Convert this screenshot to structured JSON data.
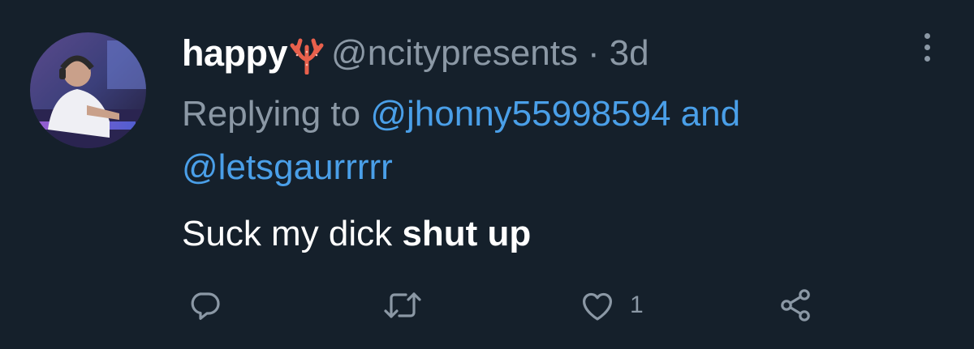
{
  "tweet": {
    "display_name": "happy",
    "name_emoji": "coral-icon",
    "handle": "@ncitypresents",
    "separator": "·",
    "time": "3d",
    "replying_prefix": "Replying to ",
    "replying_mention_1": "@jhonny55998594",
    "replying_and": " and",
    "replying_mention_2": "@letsgaurrrrr",
    "text_regular": "Suck my dick ",
    "text_bold": "shut up"
  },
  "actions": {
    "reply_icon": "reply-icon",
    "retweet_icon": "retweet-icon",
    "like_icon": "heart-icon",
    "like_count": "1",
    "share_icon": "share-icon"
  },
  "colors": {
    "background": "#15202b",
    "primary_text": "#ffffff",
    "secondary_text": "#8b98a5",
    "link": "#4a9fe8",
    "coral": "#e8604c"
  }
}
